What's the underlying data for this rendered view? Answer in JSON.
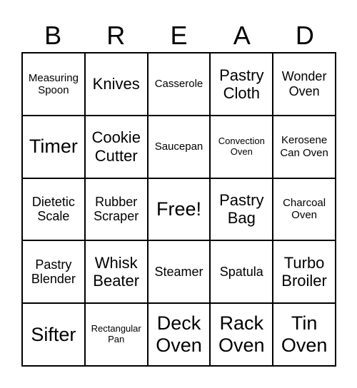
{
  "header": [
    "B",
    "R",
    "E",
    "A",
    "D"
  ],
  "cells": [
    "Measuring Spoon",
    "Knives",
    "Casserole",
    "Pastry Cloth",
    "Wonder Oven",
    "Timer",
    "Cookie Cutter",
    "Saucepan",
    "Convection Oven",
    "Kerosene Can Oven",
    "Dietetic Scale",
    "Rubber Scraper",
    "Free!",
    "Pastry Bag",
    "Charcoal Oven",
    "Pastry Blender",
    "Whisk Beater",
    "Steamer",
    "Spatula",
    "Turbo Broiler",
    "Sifter",
    "Rectangular Pan",
    "Deck Oven",
    "Rack Oven",
    "Tin Oven"
  ]
}
